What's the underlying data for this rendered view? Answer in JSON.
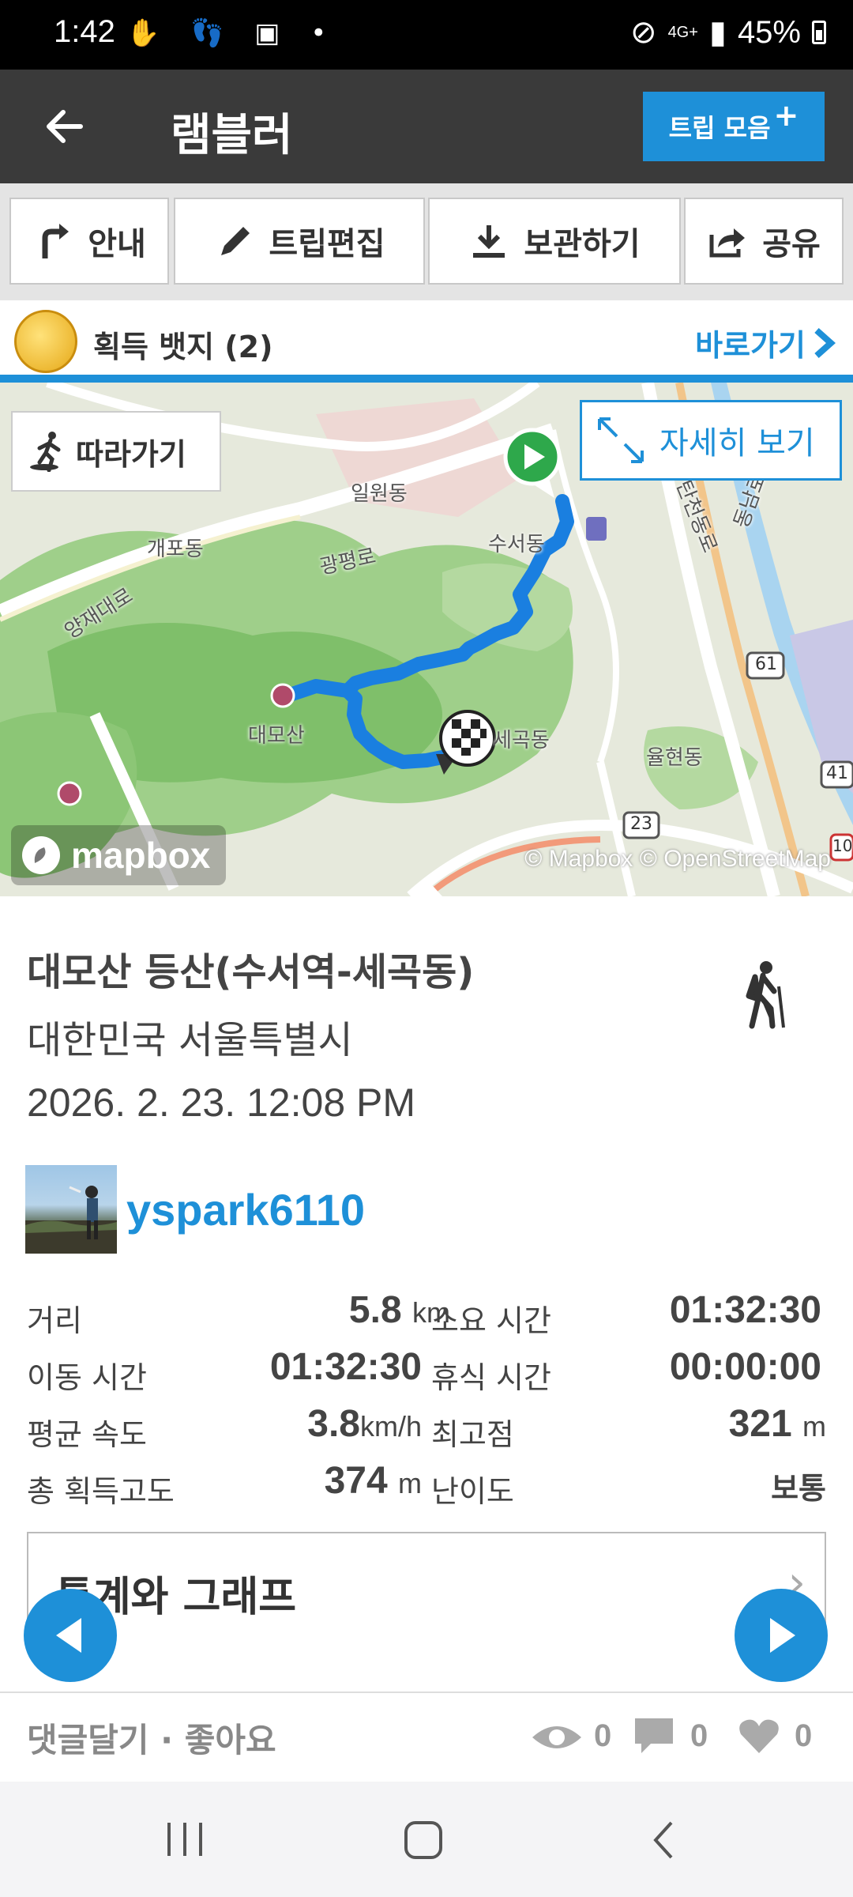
{
  "status_bar": {
    "time": "1:42",
    "battery": "45%",
    "network": "4G+"
  },
  "app_bar": {
    "title": "램블러",
    "trip_collection_label": "트립 모음"
  },
  "toolbar": {
    "guide_label": "안내",
    "edit_label": "트립편집",
    "save_label": "보관하기",
    "share_label": "공유"
  },
  "badge": {
    "label": "획득 뱃지 (2)",
    "goto_label": "바로가기"
  },
  "map": {
    "follow_label": "따라가기",
    "detail_label": "자세히 보기",
    "mapbox_label": "mapbox",
    "attribution": "© Mapbox © OpenStreetMap",
    "labels": {
      "ilwon": "일원동",
      "gaepo": "개포동",
      "gwangpyeong": "광평로",
      "suseo": "수서동",
      "yangjae": "양재대로",
      "daemosan": "대모산",
      "segok": "세곡동",
      "yulhyeon": "율현동",
      "dongnam": "동남로",
      "tancheon": "탄천동로",
      "route61": "61",
      "route23": "23",
      "route41": "41",
      "route10": "10"
    }
  },
  "trip": {
    "title": "대모산 등산(수서역-세곡동)",
    "location": "대한민국 서울특별시",
    "date": "2026. 2. 23. 12:08 PM",
    "user": "yspark6110",
    "activity_icon": "hiking-icon"
  },
  "stats": {
    "distance_label": "거리",
    "distance_value": "5.8",
    "distance_unit": "km",
    "duration_label": "소요 시간",
    "duration_value": "01:32:30",
    "moving_label": "이동 시간",
    "moving_value": "01:32:30",
    "rest_label": "휴식 시간",
    "rest_value": "00:00:00",
    "speed_label": "평균 속도",
    "speed_value": "3.8",
    "speed_unit": "km/h",
    "max_alt_label": "최고점",
    "max_alt_value": "321",
    "max_alt_unit": "m",
    "gain_label": "총 획득고도",
    "gain_value": "374",
    "gain_unit": "m",
    "difficulty_label": "난이도",
    "difficulty_value": "보통"
  },
  "graph_card": {
    "label": "통계와 그래프"
  },
  "footer": {
    "comment_like": "댓글달기 · 좋아요",
    "views": "0",
    "comments": "0",
    "likes": "0"
  },
  "colors": {
    "accent": "#1e90d8",
    "app_bar": "#3a3a3a"
  }
}
